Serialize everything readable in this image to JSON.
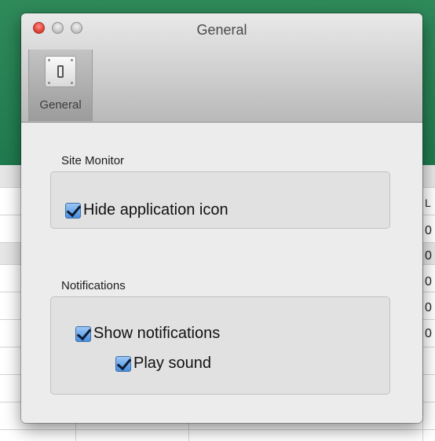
{
  "window": {
    "title": "General"
  },
  "toolbar": {
    "items": [
      {
        "label": "General",
        "icon": "switch-icon",
        "selected": true
      }
    ]
  },
  "sections": {
    "site_monitor": {
      "title": "Site Monitor",
      "options": [
        {
          "label": "Hide application icon",
          "checked": true
        }
      ]
    },
    "notifications": {
      "title": "Notifications",
      "options": [
        {
          "label": "Show notifications",
          "checked": true
        },
        {
          "label": "Play sound",
          "checked": true
        }
      ]
    }
  },
  "background": {
    "header_cell": "L",
    "cells": [
      "0",
      "0",
      "0",
      "0",
      "0"
    ]
  },
  "colors": {
    "close_button": "#e0443a",
    "checkbox_accent": "#4a8fe0",
    "background_app_green": "#1f7a4e"
  }
}
